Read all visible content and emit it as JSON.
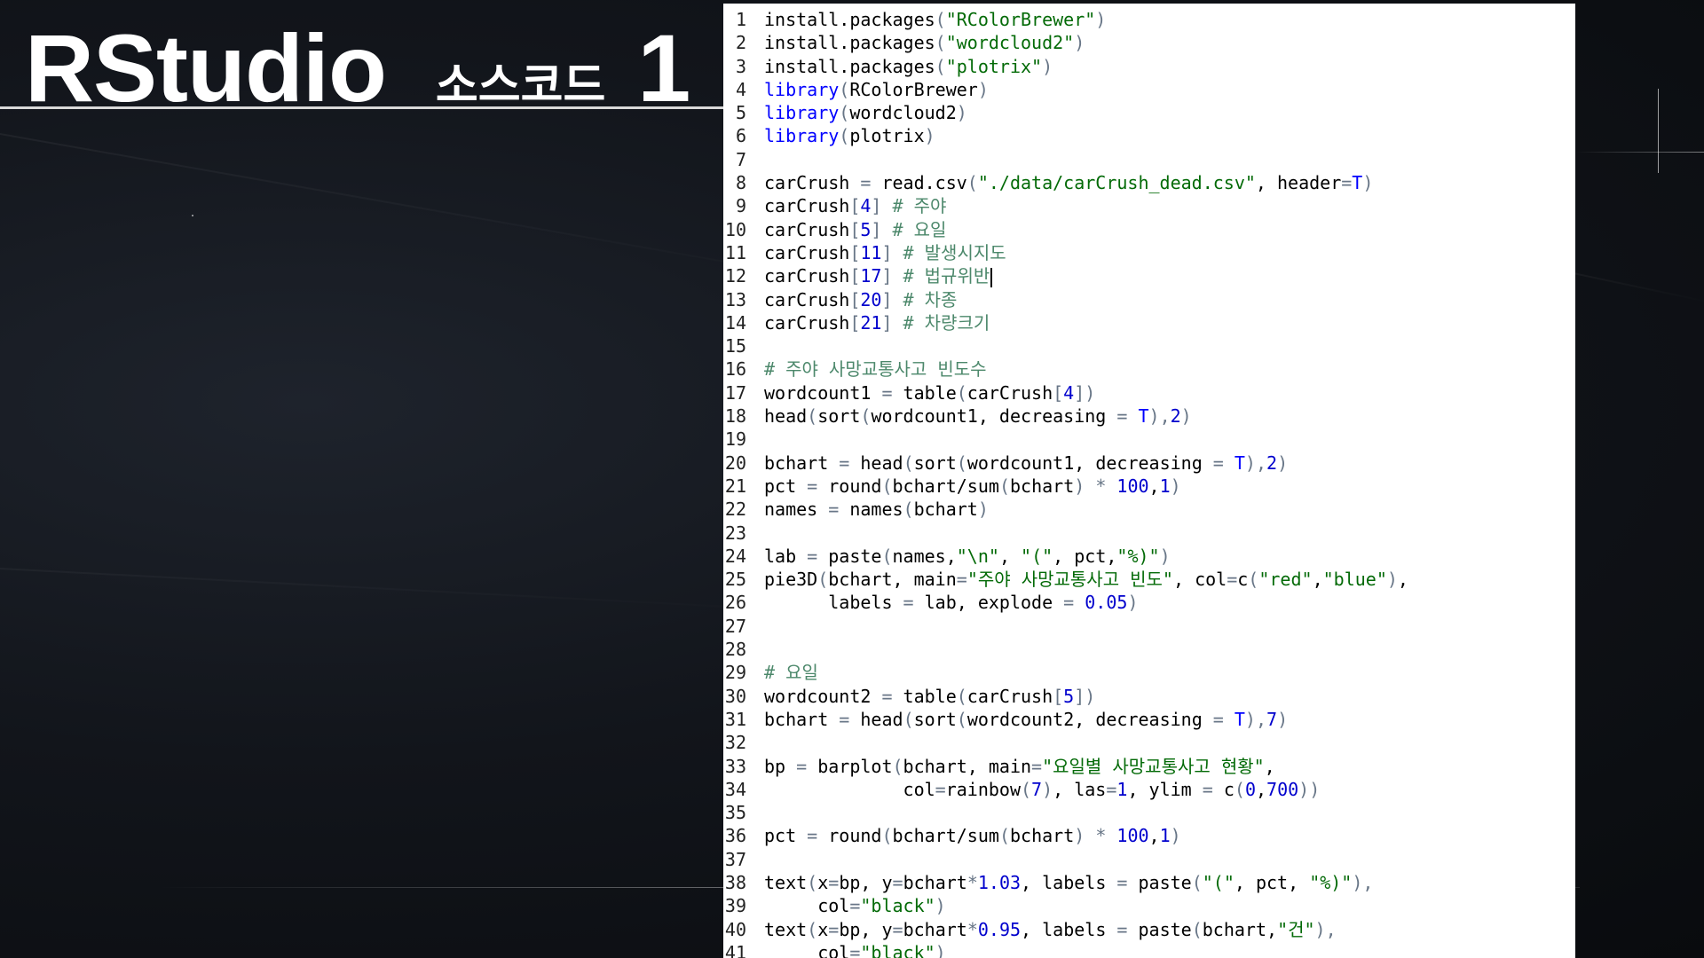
{
  "slide": {
    "title_main": "RStudio",
    "title_sub": "소스코드",
    "title_num": "1"
  },
  "editor": {
    "lines": [
      [
        [
          "plain",
          "install.packages"
        ],
        [
          "punc",
          "("
        ],
        [
          "str",
          "\"RColorBrewer\""
        ],
        [
          "punc",
          ")"
        ]
      ],
      [
        [
          "plain",
          "install.packages"
        ],
        [
          "punc",
          "("
        ],
        [
          "str",
          "\"wordcloud2\""
        ],
        [
          "punc",
          ")"
        ]
      ],
      [
        [
          "plain",
          "install.packages"
        ],
        [
          "punc",
          "("
        ],
        [
          "str",
          "\"plotrix\""
        ],
        [
          "punc",
          ")"
        ]
      ],
      [
        [
          "kw",
          "library"
        ],
        [
          "punc",
          "("
        ],
        [
          "plain",
          "RColorBrewer"
        ],
        [
          "punc",
          ")"
        ]
      ],
      [
        [
          "kw",
          "library"
        ],
        [
          "punc",
          "("
        ],
        [
          "plain",
          "wordcloud2"
        ],
        [
          "punc",
          ")"
        ]
      ],
      [
        [
          "kw",
          "library"
        ],
        [
          "punc",
          "("
        ],
        [
          "plain",
          "plotrix"
        ],
        [
          "punc",
          ")"
        ]
      ],
      [],
      [
        [
          "plain",
          "carCrush "
        ],
        [
          "punc",
          "="
        ],
        [
          "plain",
          " read.csv"
        ],
        [
          "punc",
          "("
        ],
        [
          "str",
          "\"./data/carCrush_dead.csv\""
        ],
        [
          "plain",
          ", header"
        ],
        [
          "punc",
          "="
        ],
        [
          "kw",
          "T"
        ],
        [
          "punc",
          ")"
        ]
      ],
      [
        [
          "plain",
          "carCrush"
        ],
        [
          "punc",
          "["
        ],
        [
          "num",
          "4"
        ],
        [
          "punc",
          "]"
        ],
        [
          "com",
          " # 주야"
        ]
      ],
      [
        [
          "plain",
          "carCrush"
        ],
        [
          "punc",
          "["
        ],
        [
          "num",
          "5"
        ],
        [
          "punc",
          "]"
        ],
        [
          "com",
          " # 요일"
        ]
      ],
      [
        [
          "plain",
          "carCrush"
        ],
        [
          "punc",
          "["
        ],
        [
          "num",
          "11"
        ],
        [
          "punc",
          "]"
        ],
        [
          "com",
          " # 발생시지도"
        ]
      ],
      [
        [
          "plain",
          "carCrush"
        ],
        [
          "punc",
          "["
        ],
        [
          "num",
          "17"
        ],
        [
          "punc",
          "]"
        ],
        [
          "com",
          " # 법규위반"
        ]
      ],
      [
        [
          "plain",
          "carCrush"
        ],
        [
          "punc",
          "["
        ],
        [
          "num",
          "20"
        ],
        [
          "punc",
          "]"
        ],
        [
          "com",
          " # 차종"
        ]
      ],
      [
        [
          "plain",
          "carCrush"
        ],
        [
          "punc",
          "["
        ],
        [
          "num",
          "21"
        ],
        [
          "punc",
          "]"
        ],
        [
          "com",
          " # 차량크기"
        ]
      ],
      [],
      [
        [
          "com",
          "# 주야 사망교통사고 빈도수"
        ]
      ],
      [
        [
          "plain",
          "wordcount1 "
        ],
        [
          "punc",
          "="
        ],
        [
          "plain",
          " table"
        ],
        [
          "punc",
          "("
        ],
        [
          "plain",
          "carCrush"
        ],
        [
          "punc",
          "["
        ],
        [
          "num",
          "4"
        ],
        [
          "punc",
          "])"
        ]
      ],
      [
        [
          "plain",
          "head"
        ],
        [
          "punc",
          "("
        ],
        [
          "plain",
          "sort"
        ],
        [
          "punc",
          "("
        ],
        [
          "plain",
          "wordcount1, decreasing "
        ],
        [
          "punc",
          "="
        ],
        [
          "plain",
          " "
        ],
        [
          "kw",
          "T"
        ],
        [
          "punc",
          "),"
        ],
        [
          "num",
          "2"
        ],
        [
          "punc",
          ")"
        ]
      ],
      [],
      [
        [
          "plain",
          "bchart "
        ],
        [
          "punc",
          "="
        ],
        [
          "plain",
          " head"
        ],
        [
          "punc",
          "("
        ],
        [
          "plain",
          "sort"
        ],
        [
          "punc",
          "("
        ],
        [
          "plain",
          "wordcount1, decreasing "
        ],
        [
          "punc",
          "="
        ],
        [
          "plain",
          " "
        ],
        [
          "kw",
          "T"
        ],
        [
          "punc",
          "),"
        ],
        [
          "num",
          "2"
        ],
        [
          "punc",
          ")"
        ]
      ],
      [
        [
          "plain",
          "pct "
        ],
        [
          "punc",
          "="
        ],
        [
          "plain",
          " round"
        ],
        [
          "punc",
          "("
        ],
        [
          "plain",
          "bchart/sum"
        ],
        [
          "punc",
          "("
        ],
        [
          "plain",
          "bchart"
        ],
        [
          "punc",
          ")"
        ],
        [
          "plain",
          " "
        ],
        [
          "punc",
          "*"
        ],
        [
          "plain",
          " "
        ],
        [
          "num",
          "100"
        ],
        [
          "plain",
          ","
        ],
        [
          "num",
          "1"
        ],
        [
          "punc",
          ")"
        ]
      ],
      [
        [
          "plain",
          "names "
        ],
        [
          "punc",
          "="
        ],
        [
          "plain",
          " names"
        ],
        [
          "punc",
          "("
        ],
        [
          "plain",
          "bchart"
        ],
        [
          "punc",
          ")"
        ]
      ],
      [],
      [
        [
          "plain",
          "lab "
        ],
        [
          "punc",
          "="
        ],
        [
          "plain",
          " paste"
        ],
        [
          "punc",
          "("
        ],
        [
          "plain",
          "names,"
        ],
        [
          "str",
          "\"\\n\""
        ],
        [
          "plain",
          ", "
        ],
        [
          "str",
          "\"(\""
        ],
        [
          "plain",
          ", pct,"
        ],
        [
          "str",
          "\"%)\""
        ],
        [
          "punc",
          ")"
        ]
      ],
      [
        [
          "plain",
          "pie3D"
        ],
        [
          "punc",
          "("
        ],
        [
          "plain",
          "bchart, main"
        ],
        [
          "punc",
          "="
        ],
        [
          "str",
          "\"주야 사망교통사고 빈도\""
        ],
        [
          "plain",
          ", col"
        ],
        [
          "punc",
          "="
        ],
        [
          "plain",
          "c"
        ],
        [
          "punc",
          "("
        ],
        [
          "str",
          "\"red\""
        ],
        [
          "plain",
          ","
        ],
        [
          "str",
          "\"blue\""
        ],
        [
          "punc",
          ")"
        ],
        [
          "plain",
          ","
        ]
      ],
      [
        [
          "plain",
          "      labels "
        ],
        [
          "punc",
          "="
        ],
        [
          "plain",
          " lab, explode "
        ],
        [
          "punc",
          "="
        ],
        [
          "plain",
          " "
        ],
        [
          "num",
          "0.05"
        ],
        [
          "punc",
          ")"
        ]
      ],
      [],
      [],
      [
        [
          "com",
          "# 요일"
        ]
      ],
      [
        [
          "plain",
          "wordcount2 "
        ],
        [
          "punc",
          "="
        ],
        [
          "plain",
          " table"
        ],
        [
          "punc",
          "("
        ],
        [
          "plain",
          "carCrush"
        ],
        [
          "punc",
          "["
        ],
        [
          "num",
          "5"
        ],
        [
          "punc",
          "])"
        ]
      ],
      [
        [
          "plain",
          "bchart "
        ],
        [
          "punc",
          "="
        ],
        [
          "plain",
          " head"
        ],
        [
          "punc",
          "("
        ],
        [
          "plain",
          "sort"
        ],
        [
          "punc",
          "("
        ],
        [
          "plain",
          "wordcount2, decreasing "
        ],
        [
          "punc",
          "="
        ],
        [
          "plain",
          " "
        ],
        [
          "kw",
          "T"
        ],
        [
          "punc",
          "),"
        ],
        [
          "num",
          "7"
        ],
        [
          "punc",
          ")"
        ]
      ],
      [],
      [
        [
          "plain",
          "bp "
        ],
        [
          "punc",
          "="
        ],
        [
          "plain",
          " barplot"
        ],
        [
          "punc",
          "("
        ],
        [
          "plain",
          "bchart, main"
        ],
        [
          "punc",
          "="
        ],
        [
          "str",
          "\"요일별 사망교통사고 현황\""
        ],
        [
          "plain",
          ","
        ]
      ],
      [
        [
          "plain",
          "             col"
        ],
        [
          "punc",
          "="
        ],
        [
          "plain",
          "rainbow"
        ],
        [
          "punc",
          "("
        ],
        [
          "num",
          "7"
        ],
        [
          "punc",
          ")"
        ],
        [
          "plain",
          ", las"
        ],
        [
          "punc",
          "="
        ],
        [
          "num",
          "1"
        ],
        [
          "plain",
          ", ylim "
        ],
        [
          "punc",
          "="
        ],
        [
          "plain",
          " c"
        ],
        [
          "punc",
          "("
        ],
        [
          "num",
          "0"
        ],
        [
          "plain",
          ","
        ],
        [
          "num",
          "700"
        ],
        [
          "punc",
          "))"
        ]
      ],
      [],
      [
        [
          "plain",
          "pct "
        ],
        [
          "punc",
          "="
        ],
        [
          "plain",
          " round"
        ],
        [
          "punc",
          "("
        ],
        [
          "plain",
          "bchart/sum"
        ],
        [
          "punc",
          "("
        ],
        [
          "plain",
          "bchart"
        ],
        [
          "punc",
          ")"
        ],
        [
          "plain",
          " "
        ],
        [
          "punc",
          "*"
        ],
        [
          "plain",
          " "
        ],
        [
          "num",
          "100"
        ],
        [
          "plain",
          ","
        ],
        [
          "num",
          "1"
        ],
        [
          "punc",
          ")"
        ]
      ],
      [],
      [
        [
          "plain",
          "text"
        ],
        [
          "punc",
          "("
        ],
        [
          "plain",
          "x"
        ],
        [
          "punc",
          "="
        ],
        [
          "plain",
          "bp, y"
        ],
        [
          "punc",
          "="
        ],
        [
          "plain",
          "bchart"
        ],
        [
          "punc",
          "*"
        ],
        [
          "num",
          "1.03"
        ],
        [
          "plain",
          ", labels "
        ],
        [
          "punc",
          "="
        ],
        [
          "plain",
          " paste"
        ],
        [
          "punc",
          "("
        ],
        [
          "str",
          "\"(\""
        ],
        [
          "plain",
          ", pct, "
        ],
        [
          "str",
          "\"%)\""
        ],
        [
          "punc",
          "),"
        ]
      ],
      [
        [
          "plain",
          "     col"
        ],
        [
          "punc",
          "="
        ],
        [
          "str",
          "\"black\""
        ],
        [
          "punc",
          ")"
        ]
      ],
      [
        [
          "plain",
          "text"
        ],
        [
          "punc",
          "("
        ],
        [
          "plain",
          "x"
        ],
        [
          "punc",
          "="
        ],
        [
          "plain",
          "bp, y"
        ],
        [
          "punc",
          "="
        ],
        [
          "plain",
          "bchart"
        ],
        [
          "punc",
          "*"
        ],
        [
          "num",
          "0.95"
        ],
        [
          "plain",
          ", labels "
        ],
        [
          "punc",
          "="
        ],
        [
          "plain",
          " paste"
        ],
        [
          "punc",
          "("
        ],
        [
          "plain",
          "bchart,"
        ],
        [
          "str",
          "\"건\""
        ],
        [
          "punc",
          "),"
        ]
      ],
      [
        [
          "plain",
          "     col"
        ],
        [
          "punc",
          "="
        ],
        [
          "str",
          "\"black\""
        ],
        [
          "punc",
          ")"
        ]
      ]
    ]
  }
}
